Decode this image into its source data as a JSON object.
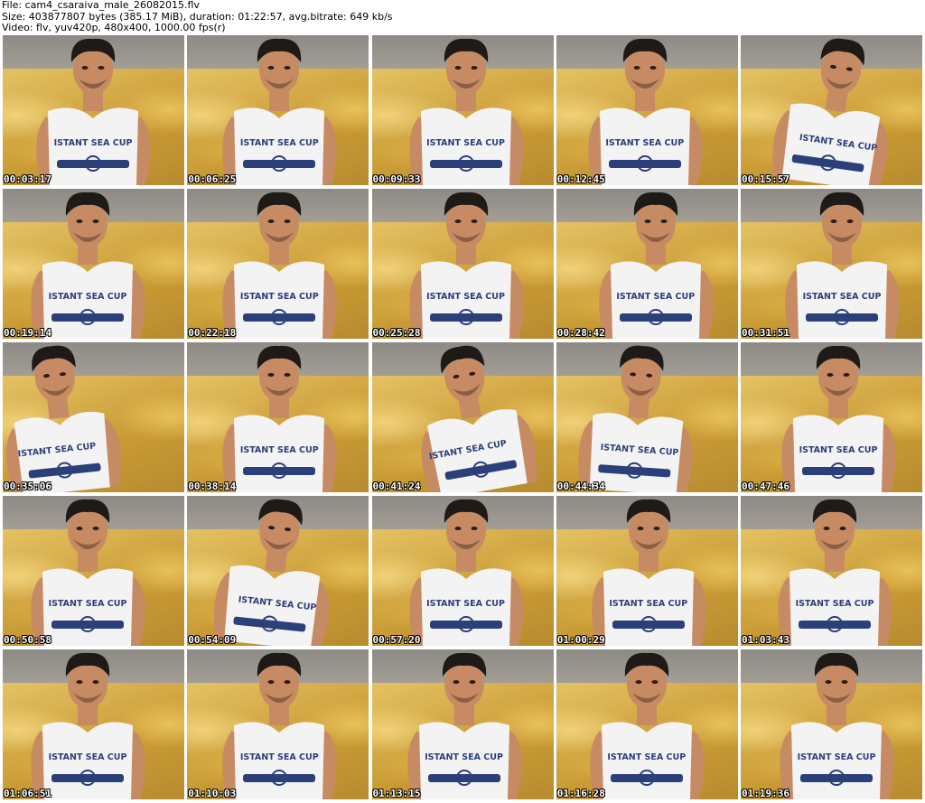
{
  "header": {
    "file_line": "File: cam4_csaraiva_male_26082015.flv",
    "size_line": "Size: 403877807 bytes (385.17 MiB), duration: 01:22:57, avg.bitrate: 649 kb/s",
    "video_line": "Video: flv, yuv420p, 480x400, 1000.00 fps(r)"
  },
  "colors": {
    "shirt": "#f3f3f3",
    "print": "#2b3f7a",
    "skin": "#c78b63",
    "hair": "#1e1a18",
    "pillow": "#d3aa47"
  },
  "thumbnails": [
    {
      "timestamp": "00:03:17",
      "caption": "ISTANT SEA CUP"
    },
    {
      "timestamp": "00:06:25",
      "caption": "ISTANT SEA CUP"
    },
    {
      "timestamp": "00:09:33",
      "caption": "ISTANT SEA CUP"
    },
    {
      "timestamp": "00:12:45",
      "caption": "ISTANT SEA CUP"
    },
    {
      "timestamp": "00:15:57",
      "caption": "ISTANT SEA CUP"
    },
    {
      "timestamp": "00:19:14",
      "caption": "ISTANT SEA CUP"
    },
    {
      "timestamp": "00:22:18",
      "caption": "ISTANT SEA CUP"
    },
    {
      "timestamp": "00:25:28",
      "caption": "ISTANT SEA CUP"
    },
    {
      "timestamp": "00:28:42",
      "caption": "ISTANT SEA CUP"
    },
    {
      "timestamp": "00:31:51",
      "caption": "ISTANT SEA CUP"
    },
    {
      "timestamp": "00:35:06",
      "caption": "ISTANT SEA CUP"
    },
    {
      "timestamp": "00:38:14",
      "caption": "ISTANT SEA CUP"
    },
    {
      "timestamp": "00:41:24",
      "caption": "ISTANT SEA CUP"
    },
    {
      "timestamp": "00:44:34",
      "caption": "ISTANT SEA CUP"
    },
    {
      "timestamp": "00:47:46",
      "caption": "ISTANT SEA CUP"
    },
    {
      "timestamp": "00:50:58",
      "caption": "ISTANT SEA CUP"
    },
    {
      "timestamp": "00:54:09",
      "caption": "ISTANT SEA CUP"
    },
    {
      "timestamp": "00:57:20",
      "caption": "ISTANT SEA CUP"
    },
    {
      "timestamp": "01:00:29",
      "caption": "ISTANT SEA CUP"
    },
    {
      "timestamp": "01:03:43",
      "caption": "ISTANT SEA CUP"
    },
    {
      "timestamp": "01:06:51",
      "caption": "ISTANT SEA CUP"
    },
    {
      "timestamp": "01:10:03",
      "caption": "ISTANT SEA CUP"
    },
    {
      "timestamp": "01:13:15",
      "caption": "ISTANT SEA CUP"
    },
    {
      "timestamp": "01:16:28",
      "caption": "ISTANT SEA CUP"
    },
    {
      "timestamp": "01:19:36",
      "caption": "ISTANT SEA CUP"
    }
  ]
}
